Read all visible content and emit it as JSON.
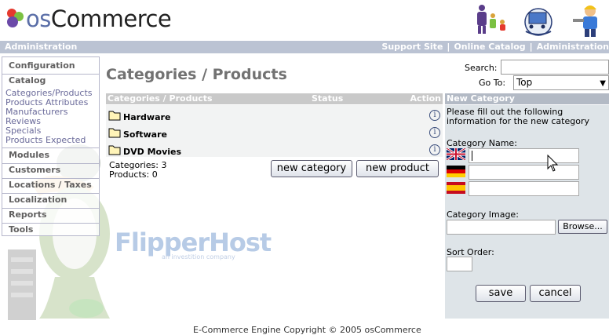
{
  "header": {
    "logo_prefix": "os",
    "logo_suffix": "Commerce"
  },
  "topbar": {
    "administration": "Administration",
    "links": [
      "Support Site",
      "Online Catalog",
      "Administration"
    ],
    "separator": "|"
  },
  "menu": {
    "configuration": "Configuration",
    "catalog": "Catalog",
    "catalog_items": [
      "Categories/Products",
      "Products Attributes",
      "Manufacturers",
      "Reviews",
      "Specials",
      "Products Expected"
    ],
    "modules": "Modules",
    "customers": "Customers",
    "locations": "Locations / Taxes",
    "localization": "Localization",
    "reports": "Reports",
    "tools": "Tools"
  },
  "watermark": {
    "brand": "FlipperHost",
    "tagline": "an investition company"
  },
  "page": {
    "title": "Categories / Products",
    "search_label": "Search:",
    "search_value": "",
    "goto_label": "Go To:",
    "goto_value": "Top"
  },
  "table": {
    "headers": [
      "Categories / Products",
      "Status",
      "Action"
    ],
    "rows": [
      "Hardware",
      "Software",
      "DVD Movies"
    ],
    "counts_categories": "Categories: 3",
    "counts_products": "Products: 0",
    "new_category": "new category",
    "new_product": "new product"
  },
  "panel": {
    "title": "New Category",
    "instructions_line1": "Please fill out the following",
    "instructions_line2": "information for the new category",
    "category_name_label": "Category Name:",
    "category_image_label": "Category Image:",
    "browse": "Browse...",
    "sort_order_label": "Sort Order:",
    "save": "save",
    "cancel": "cancel"
  },
  "footer": {
    "text": "E-Commerce Engine Copyright © 2005 osCommerce"
  },
  "colors": {
    "topbar": "#bbc3d3",
    "menu_border": "#b6b7cb",
    "table_header": "#c9c9c9",
    "panel_bg": "#dee4e8"
  }
}
